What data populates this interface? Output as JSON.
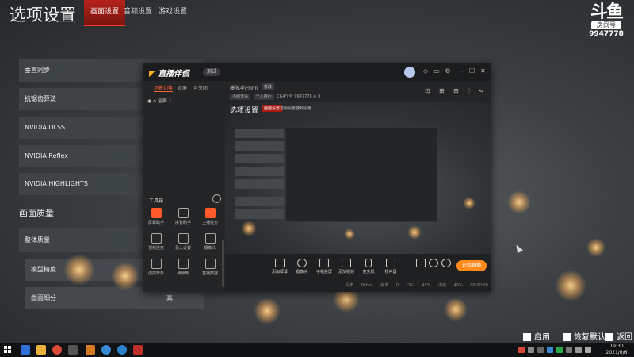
{
  "game": {
    "title": "选项设置",
    "tabs": [
      {
        "label": "画面设置",
        "active": true
      },
      {
        "label": "音频设置",
        "active": false
      },
      {
        "label": "游戏设置",
        "active": false
      }
    ],
    "brand": {
      "logo": "斗鱼",
      "room_label": "房间号",
      "room_number": "9947778"
    }
  },
  "settings": {
    "rows": [
      {
        "label": "垂直同步"
      },
      {
        "label": "抗锯齿算法"
      },
      {
        "label": "NVIDIA DLSS"
      },
      {
        "label": "NVIDIA Reflex"
      },
      {
        "label": "NVIDIA HIGHLIGHTS"
      }
    ],
    "section_heading": "画面质量",
    "quality_label": "整体质量",
    "sub_rows": [
      {
        "label": "模型精度"
      },
      {
        "label": "曲面细分",
        "value": "高"
      }
    ]
  },
  "app": {
    "logo": "直播伴侣",
    "badge": "测试",
    "scene_tabs": [
      {
        "label": "场景切换",
        "active": true
      },
      {
        "label": "双屏",
        "active": false
      },
      {
        "label": "可关闭",
        "active": false
      }
    ],
    "scene_item": "全屏 1",
    "tools_label": "工具箱",
    "tools": [
      {
        "label": "屏幕助手",
        "highlight": true
      },
      {
        "label": "房管助手",
        "highlight": false
      },
      {
        "label": "主播任务",
        "highlight": true
      },
      {
        "label": "视频连麦",
        "highlight": false
      },
      {
        "label": "录入设置",
        "highlight": false
      },
      {
        "label": "摄像头",
        "highlight": false
      },
      {
        "label": "虚拟形象",
        "highlight": false
      },
      {
        "label": "弹幕库",
        "highlight": false
      },
      {
        "label": "直播数据",
        "highlight": false
      }
    ],
    "room": {
      "title": "爆限冲记hhh",
      "tag": "修改",
      "chips": [
        "小组无语",
        "个人排行"
      ],
      "id_text": "CG4个号",
      "id_value": "9947778",
      "viewers": "0"
    },
    "preview": {
      "title": "选项设置",
      "tabs": [
        {
          "label": "画面设置",
          "active": true
        },
        {
          "label": "音频设置",
          "active": false
        },
        {
          "label": "游戏设置",
          "active": false
        }
      ]
    },
    "bottom_tools": [
      {
        "label": "添加屏幕"
      },
      {
        "label": "摄像头"
      },
      {
        "label": "手机投屏"
      },
      {
        "label": "添加视频"
      },
      {
        "label": "麦克风"
      },
      {
        "label": "扬声器"
      }
    ],
    "start_label": "开始直播",
    "status": [
      "码率 0kbps",
      "帧率 0",
      "CPU 45%",
      "内存 40%",
      "00:00:00"
    ]
  },
  "overlay_hints": [
    "启用",
    "恢复默认",
    "返回"
  ],
  "taskbar": {
    "time": "19:30",
    "date": "2021/6/6"
  },
  "colors": {
    "accent_red": "#b4221a",
    "accent_orange": "#ff8a1e"
  }
}
